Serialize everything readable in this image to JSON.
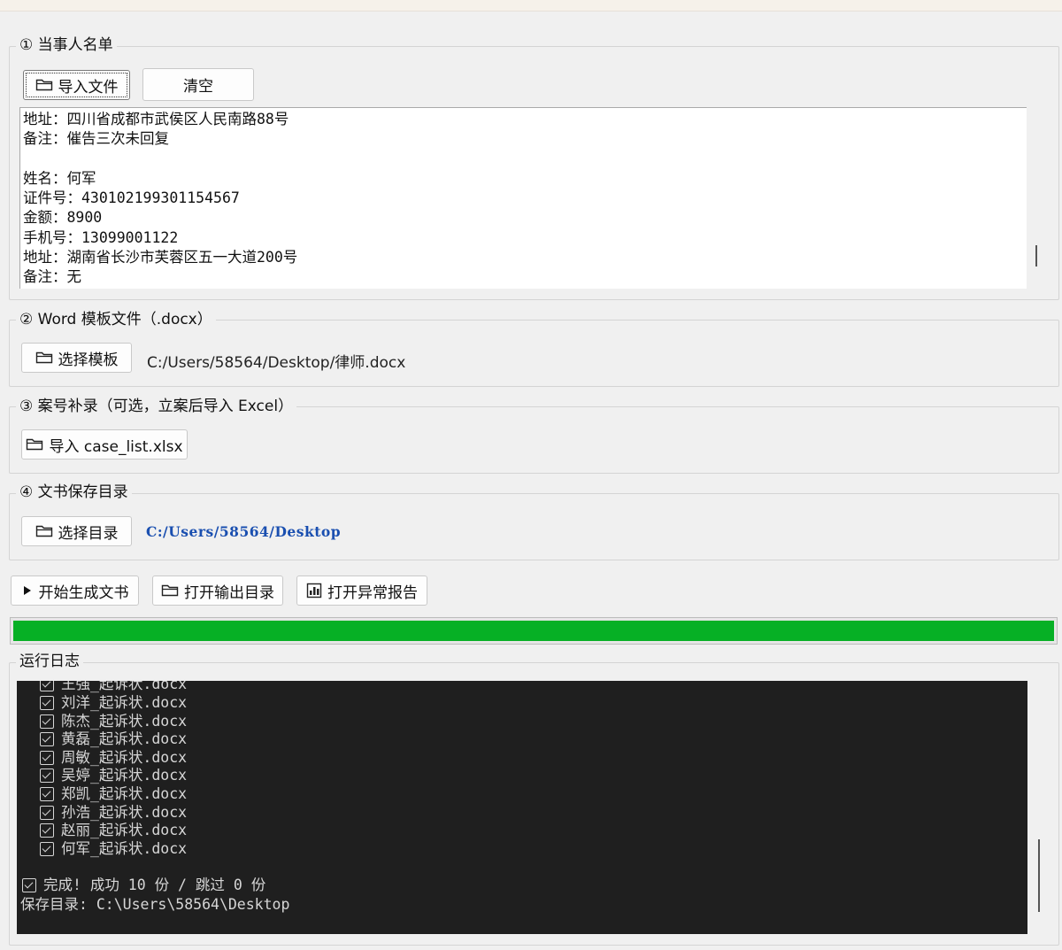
{
  "section1": {
    "title": "① 当事人名单",
    "import_label": "导入文件",
    "clear_label": "清空",
    "textarea_lines": [
      "地址：四川省成都市武侯区人民南路88号",
      "备注：催告三次未回复",
      "",
      "姓名：何军",
      "证件号：430102199301154567",
      "金额：8900",
      "手机号：13099001122",
      "地址：湖南省长沙市芙蓉区五一大道200号",
      "备注：无"
    ]
  },
  "section2": {
    "title": "② Word 模板文件（.docx）",
    "button_label": "选择模板",
    "path": "C:/Users/58564/Desktop/律师.docx"
  },
  "section3": {
    "title": "③ 案号补录（可选，立案后导入 Excel）",
    "button_label": "导入 case_list.xlsx"
  },
  "section4": {
    "title": "④ 文书保存目录",
    "button_label": "选择目录",
    "path": "C:/Users/58564/Desktop"
  },
  "actions": {
    "start_label": "开始生成文书",
    "open_output_label": "打开输出目录",
    "open_report_label": "打开异常报告"
  },
  "progress": {
    "value": 1.0,
    "color": "#06b025"
  },
  "log": {
    "title": "运行日志",
    "partial_top": "王强_起诉状.docx",
    "files": [
      "刘洋_起诉状.docx",
      "陈杰_起诉状.docx",
      "黄磊_起诉状.docx",
      "周敏_起诉状.docx",
      "吴婷_起诉状.docx",
      "郑凯_起诉状.docx",
      "孙浩_起诉状.docx",
      "赵丽_起诉状.docx",
      "何军_起诉状.docx"
    ],
    "done_line": "完成! 成功 10 份 / 跳过 0 份",
    "save_line": "保存目录: C:\\Users\\58564\\Desktop"
  },
  "icons": {
    "folder": "folder-icon",
    "play": "play-icon",
    "chart": "chart-icon",
    "checkbox": "checkbox-icon"
  }
}
